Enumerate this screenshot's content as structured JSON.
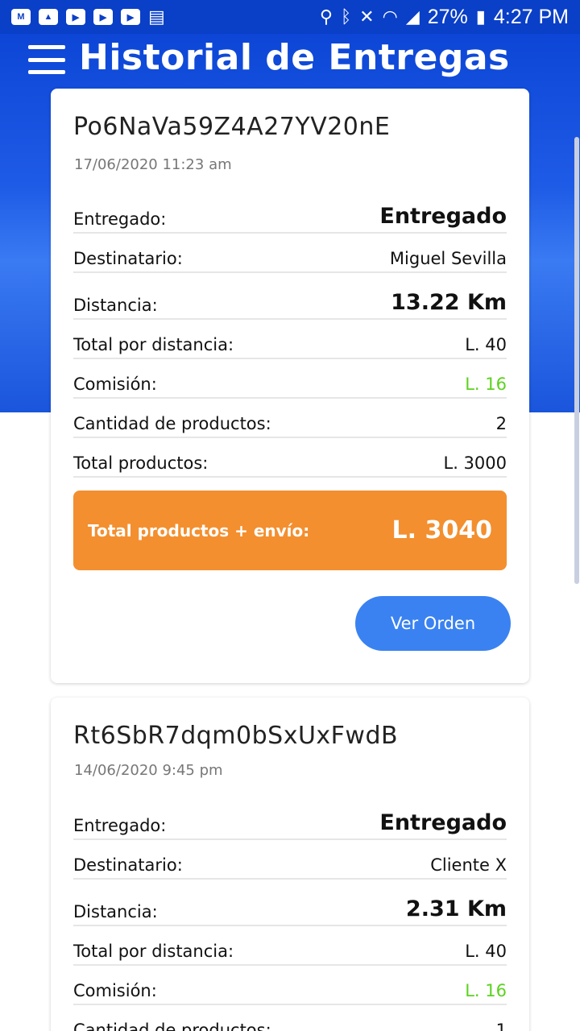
{
  "status_bar": {
    "battery": "27%",
    "time": "4:27 PM",
    "left_icons": [
      "gmail-icon",
      "image-icon",
      "youtube-icon",
      "youtube-icon",
      "youtube-icon",
      "barcode-icon"
    ],
    "right_icons": [
      "location-icon",
      "bluetooth-icon",
      "mute-icon",
      "wifi-icon",
      "signal-icon",
      "battery-icon"
    ]
  },
  "header": {
    "title": "Historial de Entregas",
    "menu_icon": "hamburger-menu-icon"
  },
  "colors": {
    "header_blue": "#0d46d6",
    "orange_total": "#f38f2f",
    "button_blue": "#3a82f1",
    "commission_green": "#5cd21e"
  },
  "orders": [
    {
      "id": "Po6NaVa59Z4A27YV20nE",
      "date": "17/06/2020 11:23 am",
      "rows": [
        {
          "label": "Entregado:",
          "value": "Entregado"
        },
        {
          "label": "Destinatario:",
          "value": "Miguel Sevilla"
        },
        {
          "label": "Distancia:",
          "value": "13.22 Km"
        },
        {
          "label": "Total por distancia:",
          "value": "L. 40"
        },
        {
          "label": "Comisión:",
          "value": "L. 16"
        },
        {
          "label": "Cantidad de productos:",
          "value": "2"
        },
        {
          "label": "Total productos:",
          "value": "L. 3000"
        }
      ],
      "total_label": "Total productos + envío:",
      "total_value": "L. 3040",
      "button_label": "Ver Orden"
    },
    {
      "id": "Rt6SbR7dqm0bSxUxFwdB",
      "date": "14/06/2020 9:45 pm",
      "rows": [
        {
          "label": "Entregado:",
          "value": "Entregado"
        },
        {
          "label": "Destinatario:",
          "value": "Cliente X"
        },
        {
          "label": "Distancia:",
          "value": "2.31 Km"
        },
        {
          "label": "Total por distancia:",
          "value": "L. 40"
        },
        {
          "label": "Comisión:",
          "value": "L. 16"
        },
        {
          "label": "Cantidad de productos:",
          "value": "1"
        }
      ]
    }
  ]
}
